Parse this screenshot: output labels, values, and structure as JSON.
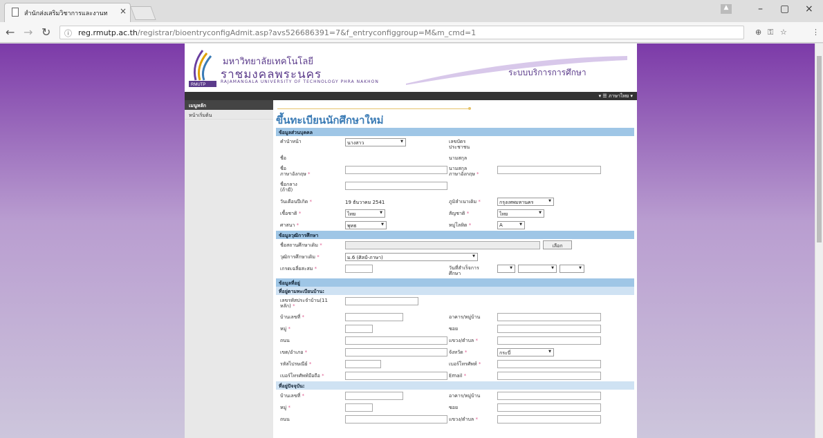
{
  "browser": {
    "tab_title": "สำนักส่งเสริมวิชาการและงานท",
    "url_host": "reg.rmutp.ac.th",
    "url_path": "/registrar/bioentryconfigAdmit.asp?avs526686391=7&f_entryconfiggroup=M&m_cmd=1"
  },
  "header": {
    "uni_line1": "มหาวิทยาลัยเทคโนโลยี",
    "uni_line2": "ราชมงคลพระนคร",
    "uni_line3": "RAJAMANGALA UNIVERSITY OF TECHNOLOGY PHRA NAKHON",
    "logo_text": "RMUTP",
    "system_name": "ระบบบริการการศึกษา",
    "lang_label": "ภาษาไทย"
  },
  "sidebar": {
    "heading": "เมนูหลัก",
    "items": [
      {
        "label": "หน้าเริ่มต้น"
      }
    ]
  },
  "page_title": "ขึ้นทะเบียนนักศึกษาใหม่",
  "sections": {
    "personal": "ข้อมูลส่วนบุคคล",
    "education": "ข้อมูลวุฒิการศึกษา",
    "address": "ข้อมูลที่อยู่",
    "reg_address": "ที่อยู่ตามทะเบียนบ้าน:",
    "cur_address": "ที่อยู่ปัจจุบัน:"
  },
  "labels": {
    "prefix": "คำนำหน้า",
    "id_card": "เลขบัตร",
    "id_card2": "ประชาชน",
    "name": "ชื่อ",
    "surname": "นามสกุล",
    "name_en": "ชื่อ",
    "name_en2": "ภาษาอังกฤษ",
    "surname_en": "นามสกุล",
    "surname_en2": "ภาษาอังกฤษ",
    "middle": "ชื่อกลาง",
    "middle2": "(ถ้ามี)",
    "birthdate": "วันเดือนปีเกิด",
    "birthplace": "ภูมิลำเนาเดิม",
    "race": "เชื้อชาติ",
    "nationality": "สัญชาติ",
    "religion": "ศาสนา",
    "blood": "หมู่โลหิต",
    "school": "ชื่อสถานศึกษาเดิม",
    "degree": "วุฒิการศึกษาเดิม",
    "gpa": "เกรดเฉลี่ยสะสม",
    "grad_date": "วันที่สำเร็จการ",
    "grad_date2": "ศึกษา",
    "house_code": "เลขรหัสประจำบ้าน(11",
    "house_code2": "หลัก)",
    "house_no": "บ้านเลขที่",
    "building": "อาคาร/หมู่บ้าน",
    "moo": "หมู่",
    "soi": "ซอย",
    "road": "ถนน",
    "subdistrict": "แขวง/ตำบล",
    "district": "เขต/อำเภอ",
    "province": "จังหวัด",
    "postcode": "รหัสไปรษณีย์",
    "phone": "เบอร์โทรศัพท์",
    "mobile": "เบอร์โทรศัพท์มือถือ",
    "email": "Email",
    "req_mark": "*"
  },
  "values": {
    "prefix": "นางสาว",
    "birthdate": "19 ธันวาคม 2541",
    "birthplace": "กรุงเทพมหานคร",
    "race": "ไทย",
    "nationality": "ไทย",
    "religion": "พุทธ",
    "blood": "A",
    "degree": "ม.6 (ศิลป์-ภาษา)",
    "province": "กระบี่",
    "choose_btn": "เลือก"
  }
}
